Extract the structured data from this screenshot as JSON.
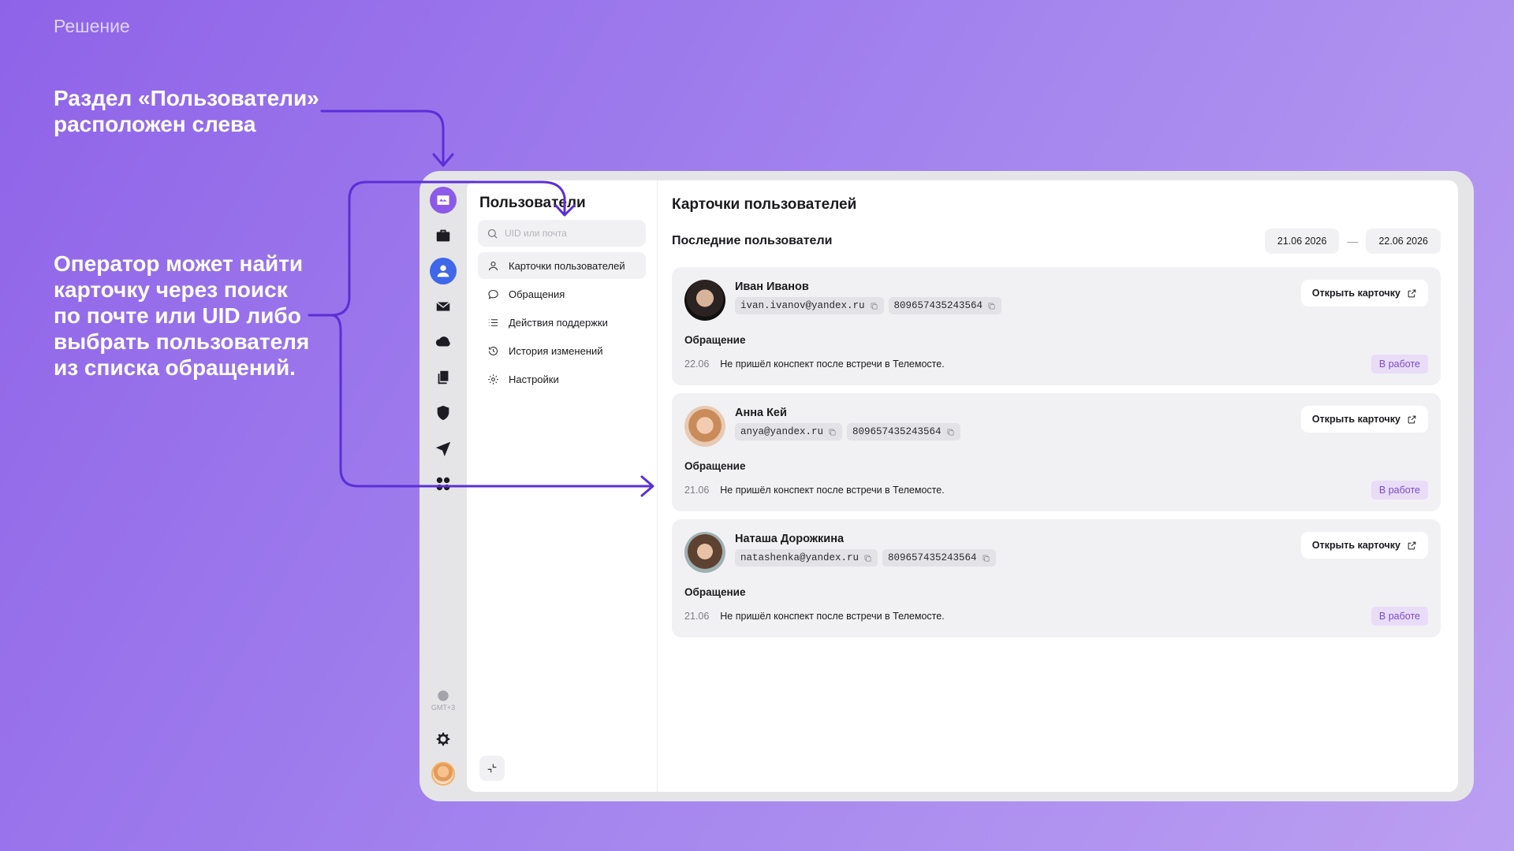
{
  "slide": {
    "label": "Решение",
    "caption_1": [
      "Раздел «Пользователи»",
      "расположен слева"
    ],
    "caption_2": [
      "Оператор может найти",
      "карточку через поиск",
      "по почте или UID либо",
      "выбрать пользователя",
      "из списка обращений."
    ]
  },
  "rail": {
    "icons": [
      "app-logo-icon",
      "briefcase-icon",
      "user-icon",
      "mail-icon",
      "cloud-icon",
      "documents-icon",
      "shield-icon",
      "send-icon",
      "apps-grid-icon"
    ],
    "active": "user-icon",
    "timezone": "GMT+3"
  },
  "subnav": {
    "title": "Пользователи",
    "search_placeholder": "UID или почта",
    "items": [
      {
        "label": "Карточки пользователей",
        "icon": "user-icon",
        "active": true
      },
      {
        "label": "Обращения",
        "icon": "chat-bubble-icon",
        "active": false
      },
      {
        "label": "Действия поддержки",
        "icon": "list-icon",
        "active": false
      },
      {
        "label": "История изменений",
        "icon": "history-icon",
        "active": false
      },
      {
        "label": "Настройки",
        "icon": "gear-icon",
        "active": false
      }
    ]
  },
  "main": {
    "title": "Карточки пользователей",
    "section_title": "Последние пользователи",
    "date_from": "21.06 2026",
    "date_separator": "—",
    "date_to": "22.06 2026",
    "cards": [
      {
        "name": "Иван Иванов",
        "email": "ivan.ivanov@yandex.ru",
        "uid": "809657435243564",
        "open_label": "Открыть карточку",
        "request_label": "Обращение",
        "request_date": "22.06",
        "request_text": "Не пришёл конспект после встречи в Телемосте.",
        "status": "В работе"
      },
      {
        "name": "Анна Кей",
        "email": "anya@yandex.ru",
        "uid": "809657435243564",
        "open_label": "Открыть карточку",
        "request_label": "Обращение",
        "request_date": "21.06",
        "request_text": "Не пришёл конспект после встречи в Телемосте.",
        "status": "В работе"
      },
      {
        "name": "Наташа Дорожкина",
        "email": "natashenka@yandex.ru",
        "uid": "809657435243564",
        "open_label": "Открыть карточку",
        "request_label": "Обращение",
        "request_date": "21.06",
        "request_text": "Не пришёл конспект после встречи в Телемосте.",
        "status": "В работе"
      }
    ]
  },
  "colors": {
    "accent": "#8c5ae8",
    "active_rail": "#3e67ea",
    "arrow": "#5b2fd6",
    "status_bg": "#e9dcf7",
    "status_text": "#7a4bc8"
  }
}
